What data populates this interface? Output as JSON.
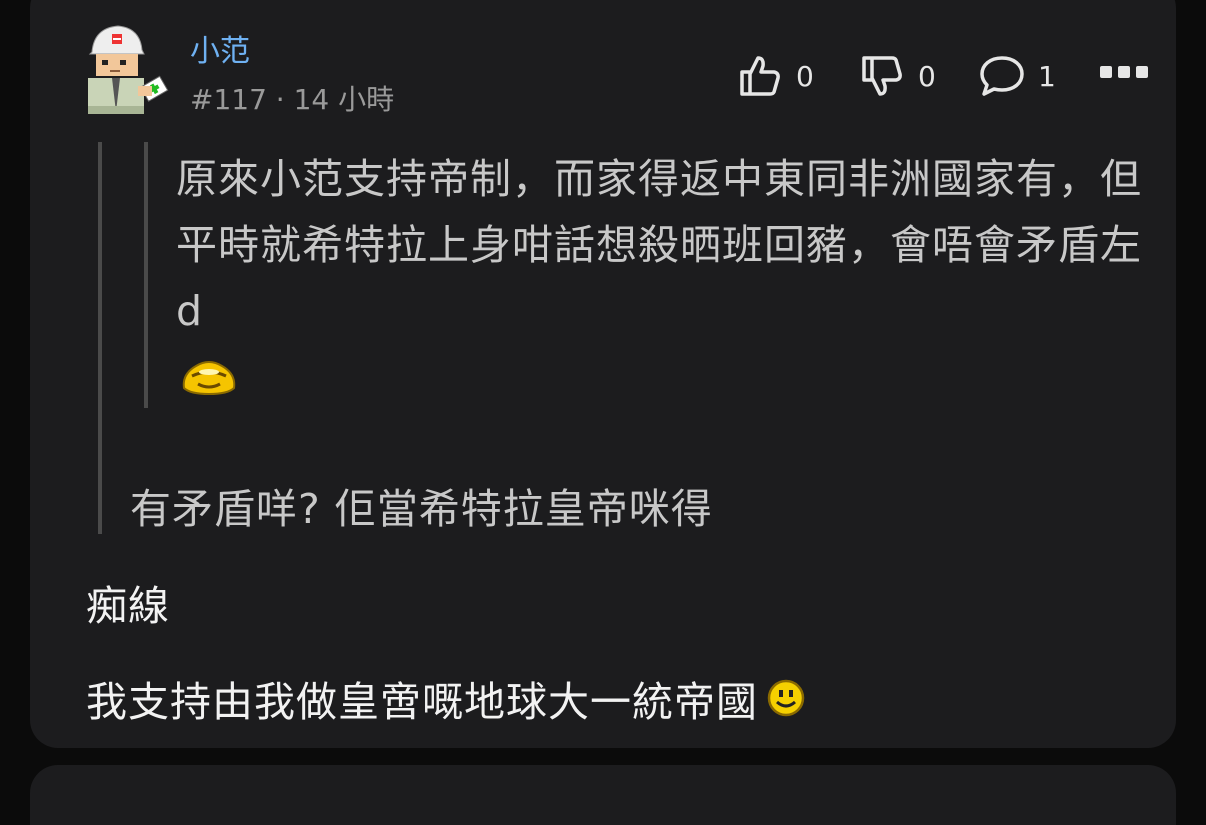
{
  "post": {
    "username": "小范",
    "meta": "#117 · 14 小時",
    "likes": "0",
    "dislikes": "0",
    "replies": "1",
    "quote_inner": "原來小范支持帝制，而家得返中東同非洲國家有，但平時就希特拉上身咁話想殺晒班回豬，會唔會矛盾左 d",
    "quote_outer": "有矛盾咩? 佢當希特拉皇帝咪得",
    "body_line1": "痴線",
    "body_line2": "我支持由我做皇啻嘅地球大一統帝國"
  },
  "icons": {
    "like": "thumbs-up-icon",
    "dislike": "thumbs-down-icon",
    "reply": "comment-bubble-icon",
    "more": "more-options-icon",
    "quote_emoticon": "yellow-emoticon",
    "smiley": "smiley-emoticon"
  },
  "colors": {
    "card_bg": "#1c1c1e",
    "username": "#6fb1f2",
    "meta": "#9a9a9a",
    "quote_text": "#c8c8c8",
    "body_text": "#f2f2f2"
  }
}
